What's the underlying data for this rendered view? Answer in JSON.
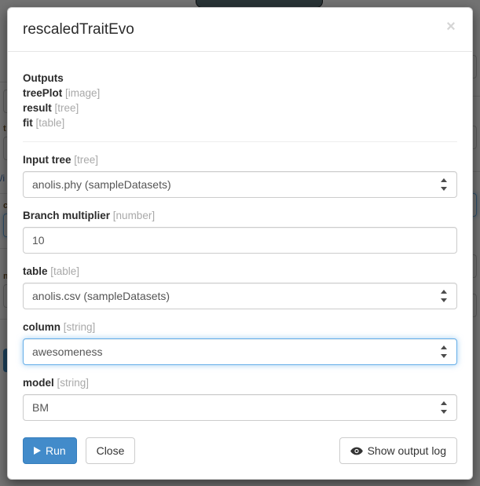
{
  "modal": {
    "title": "rescaledTraitEvo",
    "close_label": "×",
    "close_icon": "close-icon"
  },
  "outputs": {
    "heading": "Outputs",
    "items": [
      {
        "name": "treePlot",
        "type": "[image]"
      },
      {
        "name": "result",
        "type": "[tree]"
      },
      {
        "name": "fit",
        "type": "[table]"
      }
    ]
  },
  "fields": [
    {
      "label": "Input tree",
      "type_tag": "[tree]",
      "control": "select",
      "value": "anolis.phy (sampleDatasets)",
      "focused": false
    },
    {
      "label": "Branch multiplier",
      "type_tag": "[number]",
      "control": "input",
      "value": "10",
      "focused": false
    },
    {
      "label": "table",
      "type_tag": "[table]",
      "control": "select",
      "value": "anolis.csv (sampleDatasets)",
      "focused": false
    },
    {
      "label": "column",
      "type_tag": "[string]",
      "control": "select",
      "value": "awesomeness",
      "focused": true
    },
    {
      "label": "model",
      "type_tag": "[string]",
      "control": "select",
      "value": "BM",
      "focused": false
    }
  ],
  "footer": {
    "run_label": "Run",
    "run_icon": "play-icon",
    "close_label": "Close",
    "log_label": "Show output log",
    "log_icon": "eye-icon"
  },
  "colors": {
    "primary": "#428bca",
    "focus_border": "#66afe9",
    "muted_text": "#a9a9a9",
    "overlay": "rgba(0,0,0,0.55)",
    "backdrop_pill": "#5c7179"
  }
}
